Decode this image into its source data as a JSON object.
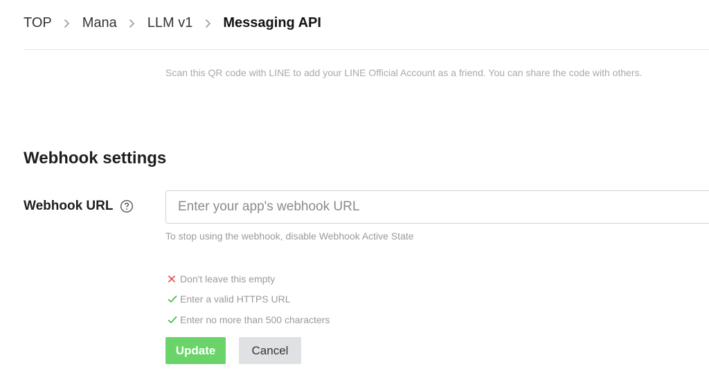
{
  "breadcrumb": {
    "items": [
      "TOP",
      "Mana",
      "LLM v1",
      "Messaging API"
    ]
  },
  "qr_hint": "Scan this QR code with LINE to add your LINE Official Account as a friend. You can share the code with others.",
  "webhook": {
    "section_title": "Webhook settings",
    "label": "Webhook URL",
    "input_value": "",
    "placeholder": "Enter your app's webhook URL",
    "hint": "To stop using the webhook, disable Webhook Active State",
    "rules": [
      {
        "status": "fail",
        "icon": "x-icon",
        "text": "Don't leave this empty"
      },
      {
        "status": "pass",
        "icon": "check-icon",
        "text": "Enter a valid HTTPS URL"
      },
      {
        "status": "pass",
        "icon": "check-icon",
        "text": "Enter no more than 500 characters"
      }
    ]
  },
  "buttons": {
    "update": "Update",
    "cancel": "Cancel"
  },
  "colors": {
    "update_button": "#6ad46a",
    "cancel_button": "#dfe1e4",
    "fail": "#e84a4a",
    "pass": "#3cbf3c"
  }
}
